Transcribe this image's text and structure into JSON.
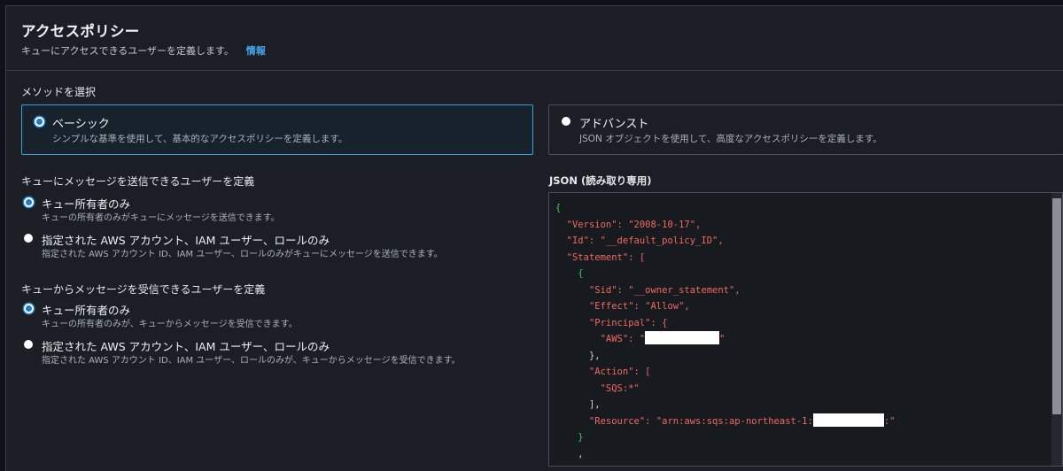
{
  "header": {
    "title": "アクセスポリシー",
    "subtitle": "キューにアクセスできるユーザーを定義します。",
    "info_link": "情報"
  },
  "method": {
    "label": "メソッドを選択",
    "options": [
      {
        "label": "ベーシック",
        "description": "シンプルな基準を使用して、基本的なアクセスポリシーを定義します。",
        "selected": true
      },
      {
        "label": "アドバンスト",
        "description": "JSON オブジェクトを使用して、高度なアクセスポリシーを定義します。",
        "selected": false
      }
    ]
  },
  "send": {
    "label": "キューにメッセージを送信できるユーザーを定義",
    "options": [
      {
        "label": "キュー所有者のみ",
        "description": "キューの所有者のみがキューにメッセージを送信できます。",
        "selected": true
      },
      {
        "label": "指定された AWS アカウント、IAM ユーザー、ロールのみ",
        "description": "指定された AWS アカウント ID、IAM ユーザー、ロールのみがキューにメッセージを送信できます。",
        "selected": false
      }
    ]
  },
  "receive": {
    "label": "キューからメッセージを受信できるユーザーを定義",
    "options": [
      {
        "label": "キュー所有者のみ",
        "description": "キューの所有者のみが、キューからメッセージを受信できます。",
        "selected": true
      },
      {
        "label": "指定された AWS アカウント、IAM ユーザー、ロールのみ",
        "description": "指定された AWS アカウント ID、IAM ユーザー、ロールのみが、キューからメッセージを受信できます。",
        "selected": false
      }
    ]
  },
  "json": {
    "title": "JSON (読み取り専用)",
    "lines": {
      "open": "{",
      "version": "\"Version\": \"2008-10-17\",",
      "id": "\"Id\": \"__default_policy_ID\",",
      "statement": "\"Statement\": [",
      "brace_open": "{",
      "sid": "\"Sid\": \"__owner_statement\",",
      "effect": "\"Effect\": \"Allow\",",
      "principal": "\"Principal\": {",
      "aws_prefix": "\"AWS\": \"",
      "aws_suffix": "\"",
      "principal_close": "},",
      "action": "\"Action\": [",
      "sqs": "\"SQS:*\"",
      "action_close": "],",
      "resource_prefix": "\"Resource\": \"arn:aws:sqs:ap-northeast-1:",
      "resource_suffix": ":\"",
      "brace_close": "}",
      "tail": ","
    }
  },
  "colors": {
    "accent": "#1e7cc8",
    "link": "#49a8ee",
    "json_key": "#f2695e",
    "json_brace": "#45c463"
  }
}
